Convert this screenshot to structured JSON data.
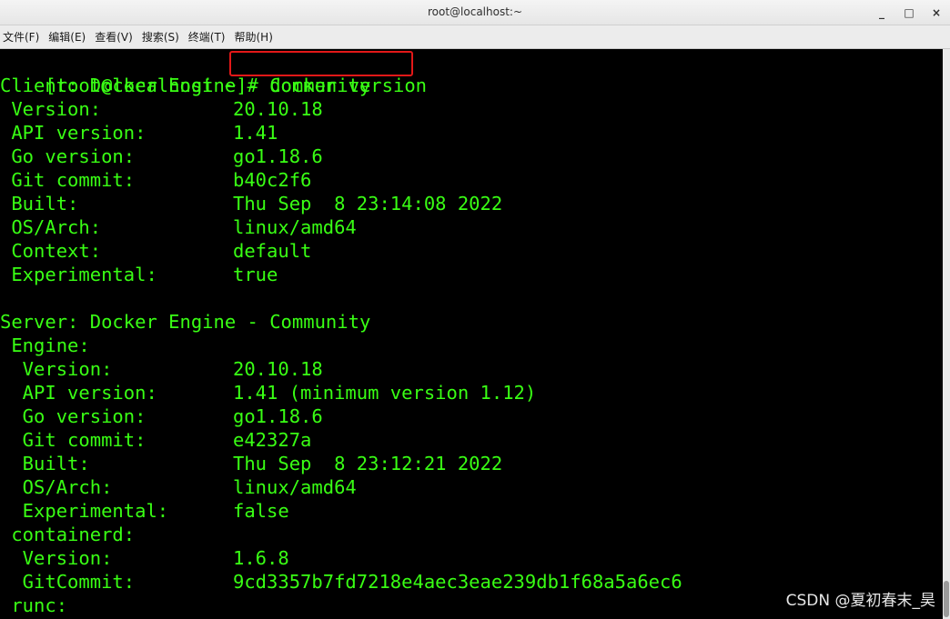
{
  "window": {
    "title": "root@localhost:~",
    "minimize": "_",
    "maximize": "□",
    "close": "×"
  },
  "menu": [
    "文件(F)",
    "编辑(E)",
    "查看(V)",
    "搜索(S)",
    "终端(T)",
    "帮助(H)"
  ],
  "terminal": {
    "prompt": "[root@localhost ~]# ",
    "command": "docker version",
    "lines": [
      {
        "label": "Client: Docker Engine - Community",
        "value": ""
      },
      {
        "label": " Version:",
        "value": "20.10.18"
      },
      {
        "label": " API version:",
        "value": "1.41"
      },
      {
        "label": " Go version:",
        "value": "go1.18.6"
      },
      {
        "label": " Git commit:",
        "value": "b40c2f6"
      },
      {
        "label": " Built:",
        "value": "Thu Sep  8 23:14:08 2022"
      },
      {
        "label": " OS/Arch:",
        "value": "linux/amd64"
      },
      {
        "label": " Context:",
        "value": "default"
      },
      {
        "label": " Experimental:",
        "value": "true"
      },
      {
        "label": "",
        "value": ""
      },
      {
        "label": "Server: Docker Engine - Community",
        "value": ""
      },
      {
        "label": " Engine:",
        "value": ""
      },
      {
        "label": "  Version:",
        "value": "20.10.18"
      },
      {
        "label": "  API version:",
        "value": "1.41 (minimum version 1.12)"
      },
      {
        "label": "  Go version:",
        "value": "go1.18.6"
      },
      {
        "label": "  Git commit:",
        "value": "e42327a"
      },
      {
        "label": "  Built:",
        "value": "Thu Sep  8 23:12:21 2022"
      },
      {
        "label": "  OS/Arch:",
        "value": "linux/amd64"
      },
      {
        "label": "  Experimental:",
        "value": "false"
      },
      {
        "label": " containerd:",
        "value": ""
      },
      {
        "label": "  Version:",
        "value": "1.6.8"
      },
      {
        "label": "  GitCommit:",
        "value": "9cd3357b7fd7218e4aec3eae239db1f68a5a6ec6"
      },
      {
        "label": " runc:",
        "value": ""
      }
    ]
  },
  "watermark": "CSDN @夏初春末_昊",
  "colors": {
    "terminal_text": "#39ff14",
    "terminal_bg": "#000000",
    "highlight_box": "#e31818"
  }
}
